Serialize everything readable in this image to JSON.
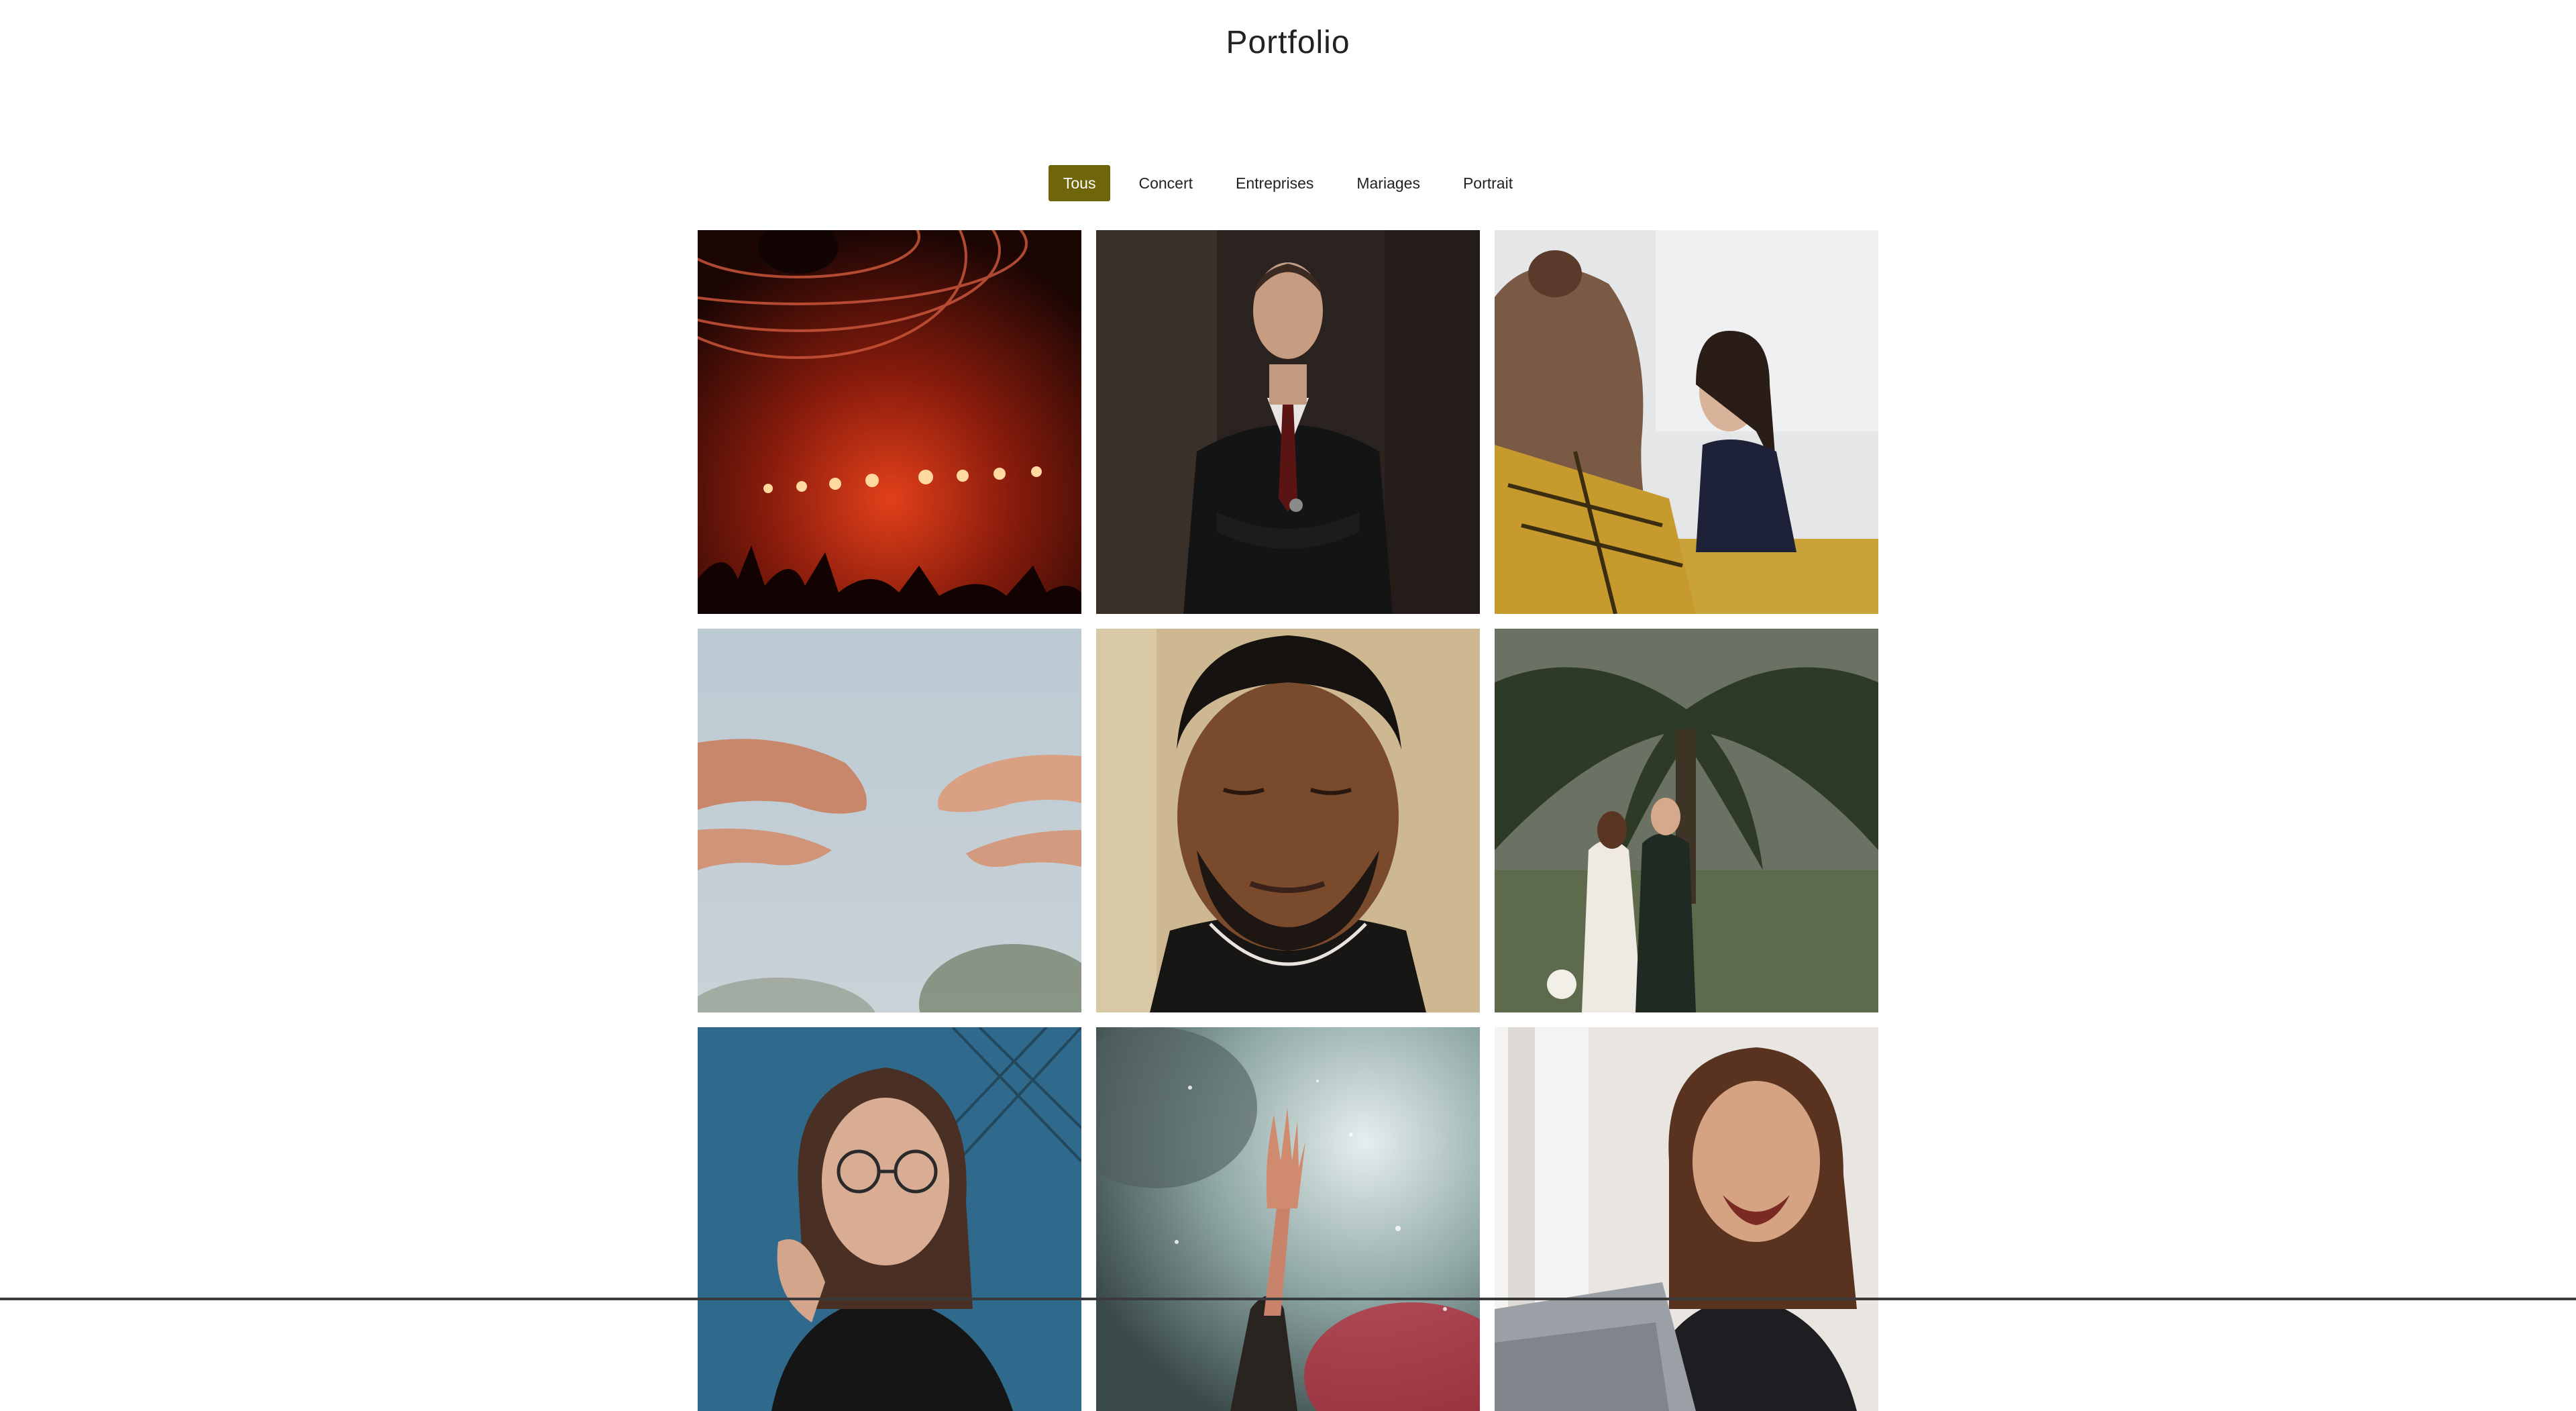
{
  "page": {
    "title": "Portfolio"
  },
  "filters": {
    "active_color": "#6f650a",
    "items": [
      {
        "label": "Tous",
        "active": true
      },
      {
        "label": "Concert",
        "active": false
      },
      {
        "label": "Entreprises",
        "active": false
      },
      {
        "label": "Mariages",
        "active": false
      },
      {
        "label": "Portrait",
        "active": false
      }
    ]
  },
  "gallery": {
    "photos": [
      {
        "subject": "concert-stage-red-lights"
      },
      {
        "subject": "man-in-suit-portrait"
      },
      {
        "subject": "smiling-woman-office"
      },
      {
        "subject": "reaching-hands-sky"
      },
      {
        "subject": "man-eyes-closed-portrait"
      },
      {
        "subject": "wedding-couple-palm-tree"
      },
      {
        "subject": "woman-glasses-portrait"
      },
      {
        "subject": "concert-raised-hand-smoke"
      },
      {
        "subject": "laughing-woman-laptop"
      }
    ]
  }
}
